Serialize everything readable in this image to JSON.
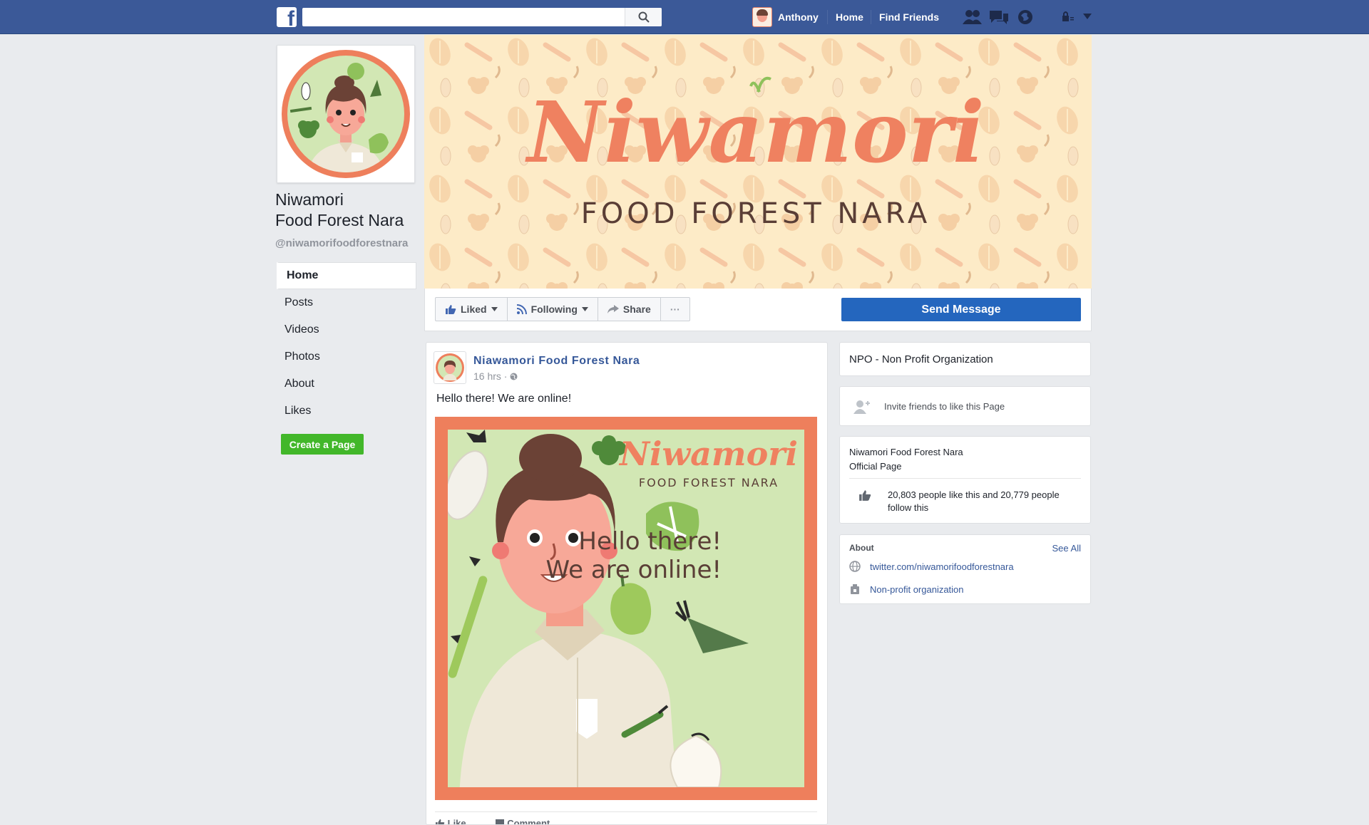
{
  "topbar": {
    "logo_letter": "f",
    "search_placeholder": "",
    "user_name": "Anthony",
    "nav_home": "Home",
    "nav_find_friends": "Find Friends",
    "icons": [
      "friend-requests-icon",
      "messages-icon",
      "notifications-icon",
      "privacy-shortcuts-icon",
      "account-menu-icon"
    ]
  },
  "page": {
    "name_line1": "Niwamori",
    "name_line2": "Food Forest Nara",
    "handle": "@niwamorifoodforestnara"
  },
  "left_nav": {
    "items": [
      "Home",
      "Posts",
      "Videos",
      "Photos",
      "About",
      "Likes"
    ],
    "active": "Home",
    "create_page": "Create a Page"
  },
  "cover": {
    "title": "Niwamori",
    "subtitle": "FOOD FOREST NARA"
  },
  "actions": {
    "liked": "Liked",
    "following": "Following",
    "share": "Share",
    "more": "···",
    "send_message": "Send Message"
  },
  "post": {
    "author": "Niawamori Food Forest Nara",
    "time": "16 hrs · ",
    "text": "Hello there! We are online!",
    "image_title": "Niwamori",
    "image_subtitle": "FOOD FOREST NARA",
    "image_line1": "Hello there!",
    "image_line2": "We are online!",
    "footer_like": "Like",
    "footer_comment": "Comment"
  },
  "sidebar": {
    "category": "NPO - Non Profit Organization",
    "invite": "Invite friends to like this Page",
    "official_line1": "Niwamori Food Forest Nara",
    "official_line2": "Official Page",
    "likes_text": "20,803 people like this and 20,779 people follow this",
    "about_heading": "About",
    "see_all": "See All",
    "website": "twitter.com/niwamorifoodforestnara",
    "org_type": "Non-profit organization"
  },
  "colors": {
    "topbar": "#3b5998",
    "brand_orange": "#ee7f5c",
    "cover_bg": "#fdebc7",
    "post_image_bg": "#d2e7b4",
    "send_button": "#2466be",
    "create_button": "#42b72a"
  }
}
